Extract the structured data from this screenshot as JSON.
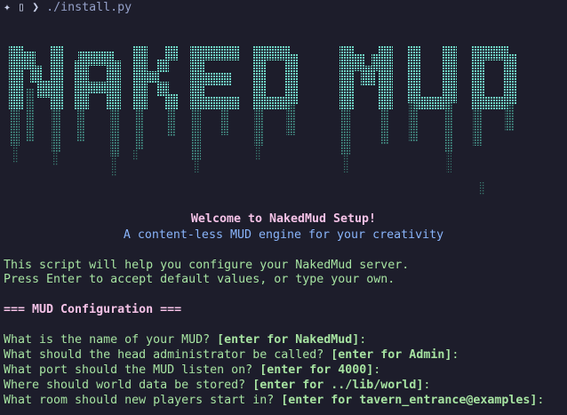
{
  "prompt": {
    "icon": "sparkle-icon",
    "folder_icon": "folder-icon",
    "arrow": "❯",
    "command": "./install.py"
  },
  "banner": {
    "text": "NAKED MUD",
    "color": "#5fd7c0"
  },
  "welcome": {
    "title": "Welcome to NakedMud Setup!",
    "subtitle": "A content-less MUD engine for your creativity"
  },
  "intro": {
    "line1": "This script will help you configure your NakedMud server.",
    "line2": "Press Enter to accept default values, or type your own."
  },
  "section": {
    "header": "=== MUD Configuration ==="
  },
  "questions": [
    {
      "q": "What is the name of your MUD? ",
      "hint": "[enter for NakedMud]",
      "tail": ":"
    },
    {
      "q": "What should the head administrator be called? ",
      "hint": "[enter for Admin]",
      "tail": ":"
    },
    {
      "q": "What port should the MUD listen on? ",
      "hint": "[enter for 4000]",
      "tail": ":"
    },
    {
      "q": "Where should world data be stored? ",
      "hint": "[enter for ../lib/world]",
      "tail": ":"
    },
    {
      "q": "What room should new players start in? ",
      "hint": "[enter for tavern_entrance@examples]",
      "tail": ":"
    }
  ]
}
